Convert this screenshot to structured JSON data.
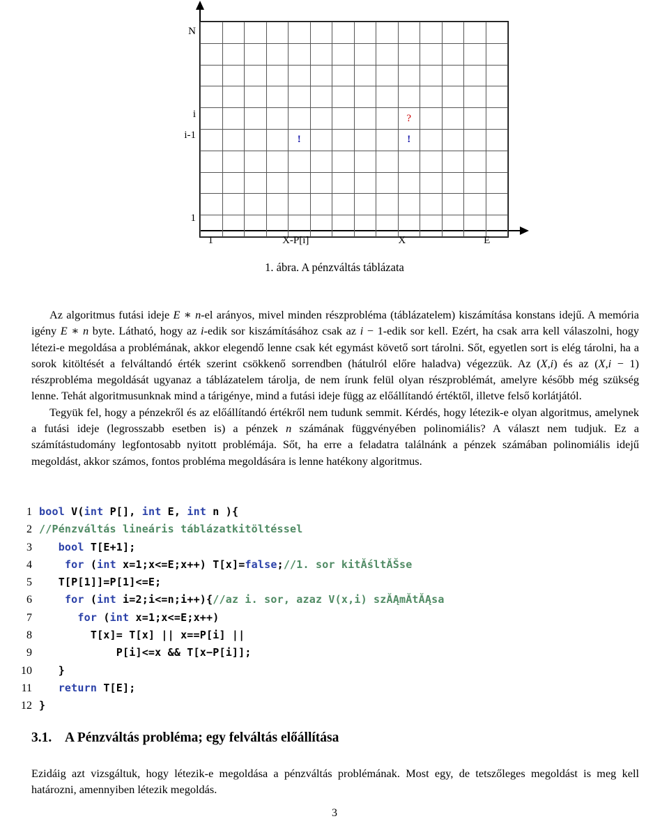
{
  "figure": {
    "caption": "1. ábra. A pénzváltás táblázata",
    "y_axis_labels": [
      "N",
      "i",
      "i-1",
      "1"
    ],
    "y_axis_label_rows": [
      1,
      5,
      6,
      10
    ],
    "x_axis_labels": [
      "1",
      "X-P[i]",
      "X",
      "E"
    ],
    "x_axis_label_cols": [
      1,
      5,
      10,
      14
    ],
    "grid_rows": 10,
    "grid_cols": 14,
    "markers": [
      {
        "symbol": "?",
        "row": 5,
        "col": 10,
        "color": "#cc0000"
      },
      {
        "symbol": "!",
        "row": 6,
        "col": 5,
        "color": "#1a1aaa"
      },
      {
        "symbol": "!",
        "row": 6,
        "col": 10,
        "color": "#1a1aaa"
      }
    ]
  },
  "body": {
    "paragraph1_parts": [
      "Az algoritmus futási ideje ",
      "E",
      " ∗ ",
      "n",
      "-el arányos, mivel minden részprobléma (táblázatelem) kiszámítása konstans idejű. A memória igény ",
      "E",
      " ∗ ",
      "n",
      " byte. Látható, hogy az ",
      "i",
      "-edik sor kiszámításához csak az ",
      "i",
      " − 1-edik sor kell. Ezért, ha csak arra kell válaszolni, hogy létezi-e megoldása a problémának, akkor elegendő lenne csak két egymást követő sort tárolni. Sőt, egyetlen sort is elég tárolni, ha a sorok kitöltését a felváltandó érték szerint csökkenő sorrendben (hátulról előre haladva) végezzük. Az (",
      "X",
      ",",
      "i",
      ") és az (",
      "X",
      ",",
      "i",
      " − 1) részprobléma megoldását ugyanaz a táblázatelem tárolja, de nem írunk felül olyan részproblémát, amelyre később még szükség lenne. Tehát algoritmusunknak mind a tárigénye, mind a futási ideje függ az előállítandó értéktől, illetve felső korlátjától."
    ],
    "paragraph2_parts": [
      "Tegyük fel, hogy a pénzekről és az előállítandó értékről nem tudunk semmit. Kérdés, hogy létezik-e olyan algoritmus, amelynek a futási ideje (legrosszabb esetben is) a pénzek ",
      "n",
      " számának függvényében polinomiális? A választ nem tudjuk. Ez a számítástudomány legfontosabb nyitott problémája. Sőt, ha erre a feladatra találnánk a pénzek számában polinomiális idejű megoldást, akkor számos, fontos probléma megoldására is lenne hatékony algoritmus."
    ]
  },
  "code": {
    "lines": [
      {
        "num": "1",
        "tokens": [
          {
            "t": "kw",
            "v": "bool"
          },
          {
            "t": "lit",
            "v": " V("
          },
          {
            "t": "kw",
            "v": "int"
          },
          {
            "t": "lit",
            "v": " P[], "
          },
          {
            "t": "kw",
            "v": "int"
          },
          {
            "t": "lit",
            "v": " E, "
          },
          {
            "t": "kw",
            "v": "int"
          },
          {
            "t": "lit",
            "v": " n ){"
          }
        ]
      },
      {
        "num": "2",
        "tokens": [
          {
            "t": "cmt",
            "v": "//Pénzváltás lineáris táblázatkitöltéssel"
          }
        ]
      },
      {
        "num": "3",
        "tokens": [
          {
            "t": "lit",
            "v": "   "
          },
          {
            "t": "kw",
            "v": "bool"
          },
          {
            "t": "lit",
            "v": " T[E+1];"
          }
        ]
      },
      {
        "num": "4",
        "tokens": [
          {
            "t": "lit",
            "v": "    "
          },
          {
            "t": "kw",
            "v": "for"
          },
          {
            "t": "lit",
            "v": " ("
          },
          {
            "t": "kw",
            "v": "int"
          },
          {
            "t": "lit",
            "v": " x=1;x<=E;x++) T[x]="
          },
          {
            "t": "kw",
            "v": "false"
          },
          {
            "t": "lit",
            "v": ";"
          },
          {
            "t": "cmt",
            "v": "//1. sor kitĂśltĂŠse"
          }
        ]
      },
      {
        "num": "5",
        "tokens": [
          {
            "t": "lit",
            "v": "   T[P[1]]=P[1]<=E;"
          }
        ]
      },
      {
        "num": "6",
        "tokens": [
          {
            "t": "lit",
            "v": "    "
          },
          {
            "t": "kw",
            "v": "for"
          },
          {
            "t": "lit",
            "v": " ("
          },
          {
            "t": "kw",
            "v": "int"
          },
          {
            "t": "lit",
            "v": " i=2;i<=n;i++){"
          },
          {
            "t": "cmt",
            "v": "//az i. sor, azaz V(x,i) szĂĄmĂ­tĂĄsa"
          }
        ]
      },
      {
        "num": "7",
        "tokens": [
          {
            "t": "lit",
            "v": "      "
          },
          {
            "t": "kw",
            "v": "for"
          },
          {
            "t": "lit",
            "v": " ("
          },
          {
            "t": "kw",
            "v": "int"
          },
          {
            "t": "lit",
            "v": " x=1;x<=E;x++)"
          }
        ]
      },
      {
        "num": "8",
        "tokens": [
          {
            "t": "lit",
            "v": "        T[x]= T[x] || x==P[i] ||"
          }
        ]
      },
      {
        "num": "9",
        "tokens": [
          {
            "t": "lit",
            "v": "            P[i]<=x && T[x−P[i]];"
          }
        ]
      },
      {
        "num": "10",
        "tokens": [
          {
            "t": "lit",
            "v": "   }"
          }
        ]
      },
      {
        "num": "11",
        "tokens": [
          {
            "t": "lit",
            "v": "   "
          },
          {
            "t": "kw",
            "v": "return"
          },
          {
            "t": "lit",
            "v": " T[E];"
          }
        ]
      },
      {
        "num": "12",
        "tokens": [
          {
            "t": "lit",
            "v": "}"
          }
        ]
      }
    ]
  },
  "section": {
    "number": "3.1.",
    "title": "A Pénzváltás probléma; egy felváltás előállítása",
    "paragraph": "Ezidáig azt vizsgáltuk, hogy létezik-e megoldása a pénzváltás problémának. Most egy, de tetszőleges megoldást is meg kell határozni, amennyiben létezik megoldás."
  },
  "page_number": "3",
  "colors": {
    "marker_question": "#cc0000",
    "marker_exclaim": "#1a1aaa",
    "code_keyword": "#2b41a8",
    "code_comment": "#4f8a63",
    "grid_line": "#555555"
  }
}
